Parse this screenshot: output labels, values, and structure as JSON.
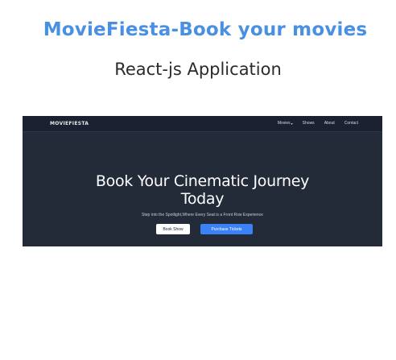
{
  "header": {
    "title": "MovieFiesta-Book your movies",
    "subtitle": "React-js Application"
  },
  "app": {
    "logo": "MOVIEFIESTA",
    "nav": [
      {
        "label": "Movies",
        "icon": "chevron-down-icon"
      },
      {
        "label": "Shows"
      },
      {
        "label": "About"
      },
      {
        "label": "Contact"
      }
    ],
    "hero": {
      "title_line1": "Book Your Cinematic Journey",
      "title_line2": "Today",
      "subtitle": "Step into the Spotlight,Where Every Seat is a Front Row Experience",
      "book_button": "Book Show",
      "purchase_button": "Purchase Tickets"
    }
  },
  "colors": {
    "title_blue": "#4a90e2",
    "app_background": "#232a38",
    "navbar_background": "#1b2130",
    "primary_button": "#3b82f6"
  }
}
